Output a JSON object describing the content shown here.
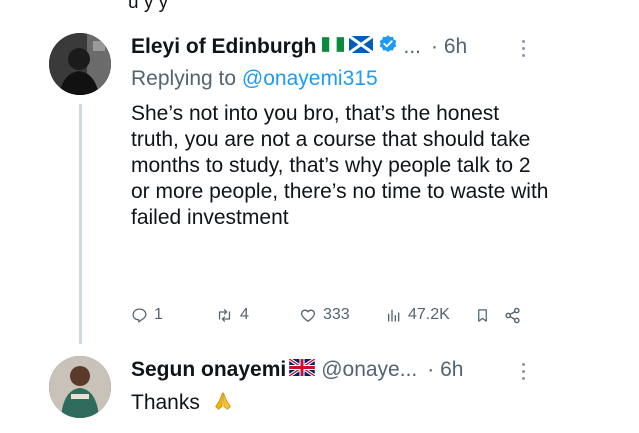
{
  "top_fragment": "u      y                                y",
  "tweet": {
    "author_name": "Eleyi of Edinburgh",
    "ellipsis": "...",
    "time": "· 6h",
    "replying_prefix": "Replying to ",
    "replying_handle": "@onayemi315",
    "text": "She’s not into you bro, that’s the honest truth, you are not a course that should take months to study, that’s why people talk to 2 or more people, there’s no time to waste with failed investment",
    "stats": {
      "replies": "1",
      "retweets": "4",
      "likes": "333",
      "views": "47.2K"
    }
  },
  "reply": {
    "author_name": "Segun onayemi",
    "handle": "@onaye...",
    "time": "· 6h",
    "text": "Thanks"
  },
  "icons": {
    "flags_author": [
      "nigeria-flag-icon",
      "scotland-flag-icon"
    ],
    "flag_reply": "uk-flag-icon",
    "verified": "verified-badge-icon",
    "emoji": "folded-hands-icon"
  },
  "colors": {
    "text": "#0f1419",
    "muted": "#536471",
    "link": "#1d9bf0",
    "verified": "#1d9bf0",
    "thread_line": "#cfd9de"
  }
}
